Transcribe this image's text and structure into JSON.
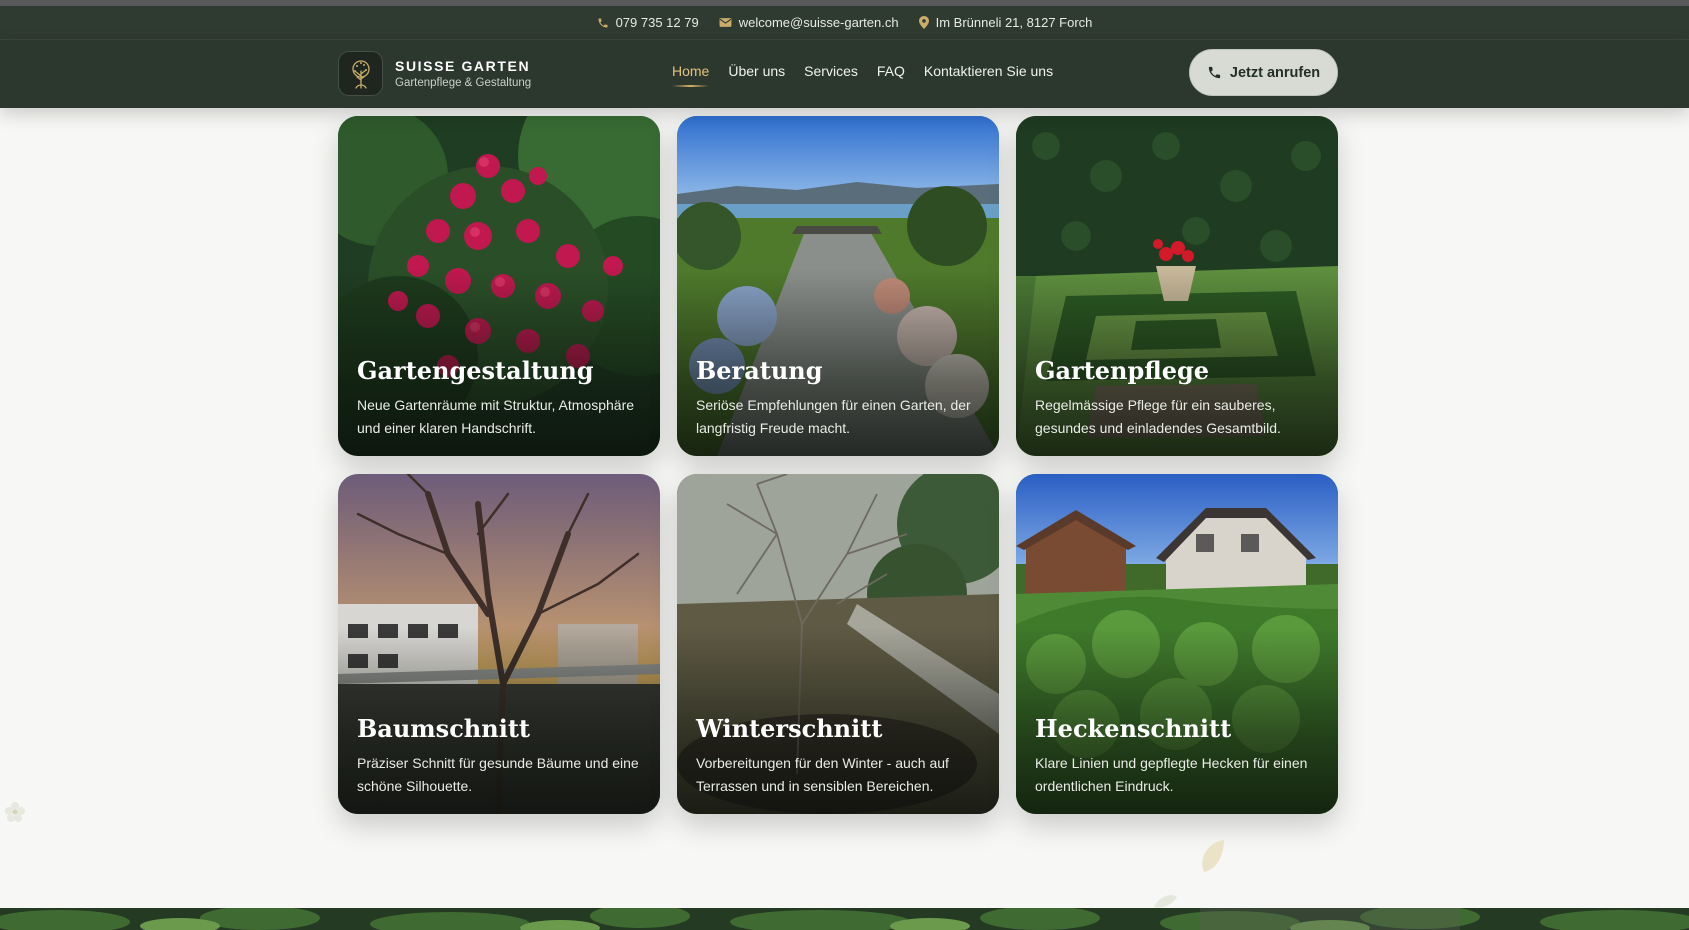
{
  "topbar": {
    "phone": "079 735 12 79",
    "email": "welcome@suisse-garten.ch",
    "address": "Im Brünneli 21, 8127 Forch",
    "icons": {
      "phone": "phone-icon",
      "email": "mail-icon",
      "address": "map-pin-icon"
    }
  },
  "header": {
    "brand_name": "SUISSE GARTEN",
    "brand_tagline": "Gartenpflege & Gestaltung",
    "logo_icon": "tree-icon",
    "nav": [
      {
        "label": "Home",
        "active": true
      },
      {
        "label": "Über uns",
        "active": false
      },
      {
        "label": "Services",
        "active": false
      },
      {
        "label": "FAQ",
        "active": false
      },
      {
        "label": "Kontaktieren Sie uns",
        "active": false
      }
    ],
    "cta_label": "Jetzt anrufen",
    "cta_icon": "phone-icon"
  },
  "services": [
    {
      "title": "Gartengestaltung",
      "description": "Neue Gartenräume mit Struktur, Atmosphäre und einer klaren Handschrift."
    },
    {
      "title": "Beratung",
      "description": "Seriöse Empfehlungen für einen Garten, der langfristig Freude macht."
    },
    {
      "title": "Gartenpflege",
      "description": "Regelmässige Pflege für ein sauberes, gesundes und einladendes Gesamtbild."
    },
    {
      "title": "Baumschnitt",
      "description": "Präziser Schnitt für gesunde Bäume und eine schöne Silhouette."
    },
    {
      "title": "Winterschnitt",
      "description": "Vorbereitungen für den Winter - auch auf Terrassen und in sensiblen Bereichen."
    },
    {
      "title": "Heckenschnitt",
      "description": "Klare Linien und gepflegte Hecken für einen ordentlichen Eindruck."
    }
  ],
  "colors": {
    "topbar_bg": "#2f3a30",
    "nav_bg": "#2c372d",
    "accent_gold": "#d6b266",
    "cta_bg": "#d7dbd3",
    "page_bg": "#f7f8f5"
  }
}
